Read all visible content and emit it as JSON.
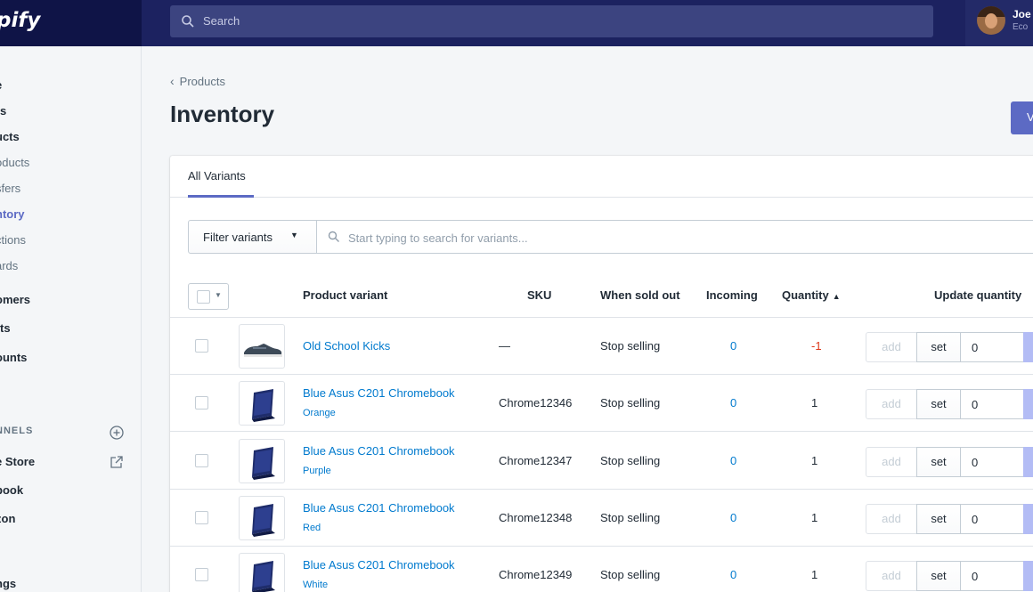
{
  "topbar": {
    "logo": "pify",
    "search_placeholder": "Search",
    "user_name": "Joe",
    "user_store": "Eco"
  },
  "sidebar": {
    "items": [
      {
        "label": "e",
        "style": "bold"
      },
      {
        "label": "rs",
        "style": "bold"
      },
      {
        "label": "ucts",
        "style": "bold"
      },
      {
        "label": "oducts",
        "style": "sub"
      },
      {
        "label": "sfers",
        "style": "sub"
      },
      {
        "label": "ntory",
        "style": "active"
      },
      {
        "label": "ctions",
        "style": "sub"
      },
      {
        "label": "ards",
        "style": "sub"
      },
      {
        "label": "omers",
        "style": "bold"
      },
      {
        "label": "rts",
        "style": "bold"
      },
      {
        "label": "ounts",
        "style": "bold"
      },
      {
        "label": "NNELS",
        "style": "heading"
      },
      {
        "label": "e Store",
        "style": "bold"
      },
      {
        "label": "book",
        "style": "bold"
      },
      {
        "label": "zon",
        "style": "bold"
      },
      {
        "label": "ngs",
        "style": "bold"
      }
    ]
  },
  "page": {
    "breadcrumb": "Products",
    "title": "Inventory",
    "primary_button": "V"
  },
  "tabs": [
    "All Variants"
  ],
  "filter": {
    "button_label": "Filter variants",
    "search_placeholder": "Start typing to search for variants..."
  },
  "table": {
    "headers": {
      "product_variant": "Product variant",
      "sku": "SKU",
      "when_sold_out": "When sold out",
      "incoming": "Incoming",
      "quantity": "Quantity",
      "update_quantity": "Update quantity"
    },
    "rows": [
      {
        "name": "Old School Kicks",
        "variant": "",
        "sku": "—",
        "when_sold_out": "Stop selling",
        "incoming": "0",
        "quantity": "-1",
        "add": "add",
        "set": "set",
        "input": "0",
        "thumb": "shoe"
      },
      {
        "name": "Blue Asus C201 Chromebook",
        "variant": "Orange",
        "sku": "Chrome12346",
        "when_sold_out": "Stop selling",
        "incoming": "0",
        "quantity": "1",
        "add": "add",
        "set": "set",
        "input": "0",
        "thumb": "laptop"
      },
      {
        "name": "Blue Asus C201 Chromebook",
        "variant": "Purple",
        "sku": "Chrome12347",
        "when_sold_out": "Stop selling",
        "incoming": "0",
        "quantity": "1",
        "add": "add",
        "set": "set",
        "input": "0",
        "thumb": "laptop"
      },
      {
        "name": "Blue Asus C201 Chromebook",
        "variant": "Red",
        "sku": "Chrome12348",
        "when_sold_out": "Stop selling",
        "incoming": "0",
        "quantity": "1",
        "add": "add",
        "set": "set",
        "input": "0",
        "thumb": "laptop"
      },
      {
        "name": "Blue Asus C201 Chromebook",
        "variant": "White",
        "sku": "Chrome12349",
        "when_sold_out": "Stop selling",
        "incoming": "0",
        "quantity": "1",
        "add": "add",
        "set": "set",
        "input": "0",
        "thumb": "laptop"
      }
    ]
  },
  "colors": {
    "topbar": "#1c2260",
    "accent": "#5c6ac4",
    "link": "#007ace",
    "negative": "#de3618"
  }
}
